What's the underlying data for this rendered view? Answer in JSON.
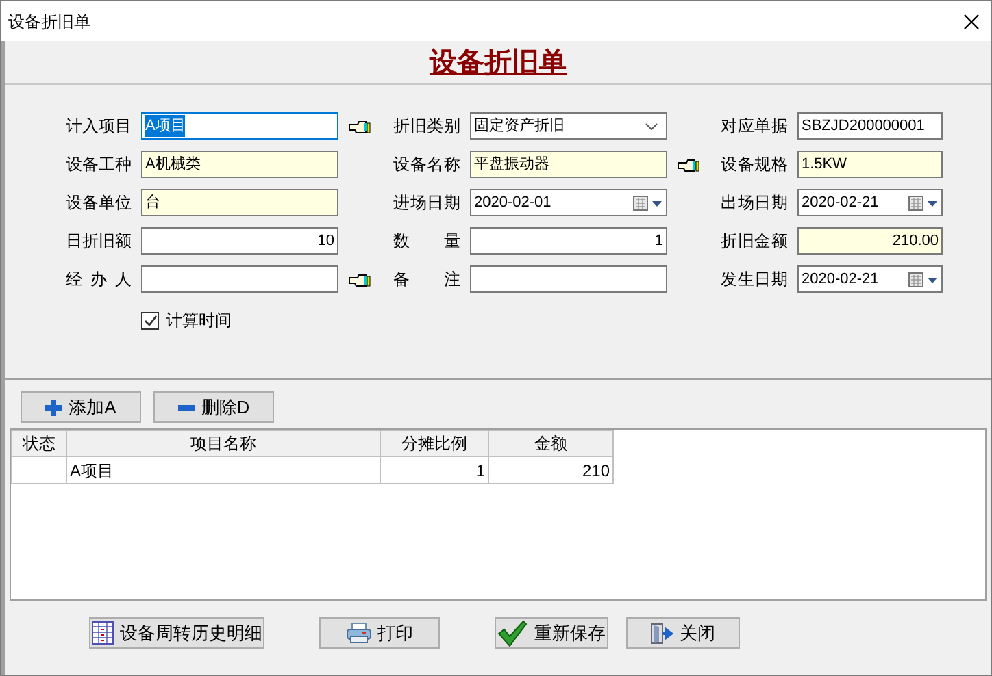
{
  "window": {
    "title": "设备折旧单"
  },
  "heading": "设备折旧单",
  "form_rows": [
    [
      {
        "label": "计入项目",
        "kind": "text",
        "value": "A项目",
        "focused": true,
        "readonly": false,
        "picker": true
      },
      {
        "label": "折旧类别",
        "kind": "select",
        "value": "固定资产折旧",
        "focused": false,
        "readonly": false
      },
      {
        "label": "对应单据",
        "kind": "text",
        "value": "SBZJD200000001",
        "focused": false,
        "readonly": false
      }
    ],
    [
      {
        "label": "设备工种",
        "kind": "text",
        "value": "A机械类",
        "focused": false,
        "readonly": true
      },
      {
        "label": "设备名称",
        "kind": "text",
        "value": "平盘振动器",
        "focused": false,
        "readonly": true,
        "picker": true
      },
      {
        "label": "设备规格",
        "kind": "text",
        "value": "1.5KW",
        "focused": false,
        "readonly": true
      }
    ],
    [
      {
        "label": "设备单位",
        "kind": "text",
        "value": "台",
        "focused": false,
        "readonly": true
      },
      {
        "label": "进场日期",
        "kind": "date",
        "value": "2020-02-01",
        "focused": false,
        "readonly": false
      },
      {
        "label": "出场日期",
        "kind": "date",
        "value": "2020-02-21",
        "focused": false,
        "readonly": false
      }
    ],
    [
      {
        "label": "日折旧额",
        "kind": "number",
        "value": "10",
        "focused": false,
        "readonly": false
      },
      {
        "label": "数 量",
        "kind": "number",
        "value": "1",
        "focused": false,
        "readonly": false
      },
      {
        "label": "折旧金额",
        "kind": "number",
        "value": "210.00",
        "focused": false,
        "readonly": true
      }
    ],
    [
      {
        "label": "经 办 人",
        "kind": "text",
        "focused": false,
        "readonly": false,
        "picker": true
      },
      {
        "label": "备 注",
        "kind": "text",
        "focused": false,
        "readonly": false
      },
      {
        "label": "发生日期",
        "kind": "date",
        "value": "2020-02-21",
        "focused": false,
        "readonly": false
      }
    ]
  ],
  "calc_time": {
    "label": "计算时间",
    "checked": true
  },
  "toolbar": [
    {
      "kind": "add",
      "label": "添加A"
    },
    {
      "kind": "remove",
      "label": "删除D"
    }
  ],
  "table": {
    "columns": [
      "状态",
      "项目名称",
      "分摊比例",
      "金额"
    ],
    "rows": [
      [
        "",
        "A项目",
        "1",
        "210"
      ]
    ]
  },
  "buttons": [
    {
      "kind": "history",
      "label": "设备周转历史明细"
    },
    {
      "kind": "print",
      "label": "打印"
    },
    {
      "kind": "save",
      "label": "重新保存"
    },
    {
      "kind": "close",
      "label": "关闭"
    }
  ]
}
